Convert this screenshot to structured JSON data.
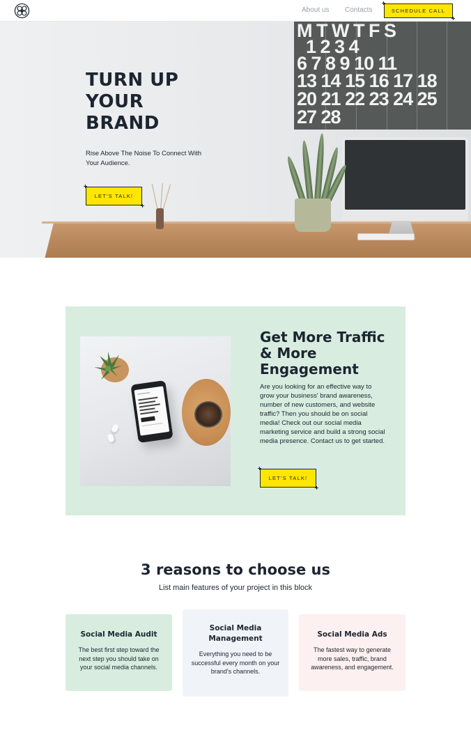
{
  "nav": {
    "logo_icon": "flower-logo-icon",
    "links": [
      "About us",
      "Contacts"
    ],
    "cta_label": "SCHEDULE CALL"
  },
  "hero": {
    "title_lines": [
      "TURN UP",
      "YOUR",
      "BRAND"
    ],
    "subtitle": "Rise Above The Noise To Connect With Your Audience.",
    "cta_label": "LET'S TALK!",
    "calendar_rows": [
      "M T W T F S",
      "  1 2 3 4",
      "6 7 8 9 10 11",
      "13 14 15 16 17 18",
      "20 21 22 23 24 25",
      "27 28"
    ]
  },
  "feature": {
    "title": "Get More Traffic & More Engagement",
    "body": "Are you looking for an effective way to grow your business' brand awareness, number of new customers, and website traffic? Then you should be on social media! Check out our social media marketing service and build a strong social media presence. Contact us to get started.",
    "cta_label": "LET'S TALK!"
  },
  "reasons": {
    "title": "3 reasons to choose us",
    "subtitle": "List main features of your project in this block",
    "cards": [
      {
        "title": "Social Media Audit",
        "body": "The best first step toward the next step you should take on your social media channels."
      },
      {
        "title": "Social Media Management",
        "body": "Everything you need to be successful every month on your brand's channels."
      },
      {
        "title": "Social Media Ads",
        "body": "The fastest way to generate more sales, traffic, brand awareness, and engagement."
      }
    ]
  },
  "colors": {
    "accent_yellow": "#ffe600",
    "text_dark": "#1c2530",
    "mint": "#d8ede0",
    "light_gray": "#f0f3f7",
    "pink": "#fdf0f0"
  }
}
